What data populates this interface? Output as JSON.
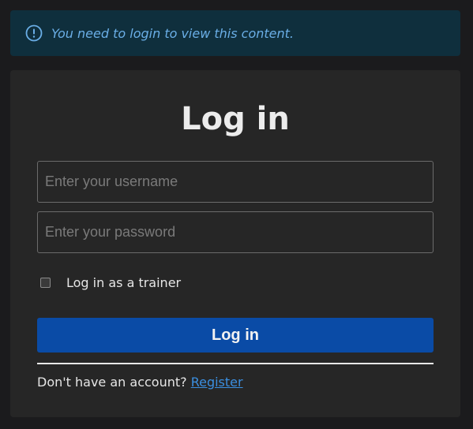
{
  "alert": {
    "icon": "info-circle-icon",
    "message": "You need to login to view this content.",
    "color": "#6aaee6"
  },
  "login": {
    "title": "Log in",
    "username_placeholder": "Enter your username",
    "password_placeholder": "Enter your password",
    "trainer_label": "Log in as a trainer",
    "trainer_checked": false,
    "submit_label": "Log in",
    "submit_color": "#0a4ba6",
    "footer_text": "Don't have an account? ",
    "register_link": "Register"
  }
}
